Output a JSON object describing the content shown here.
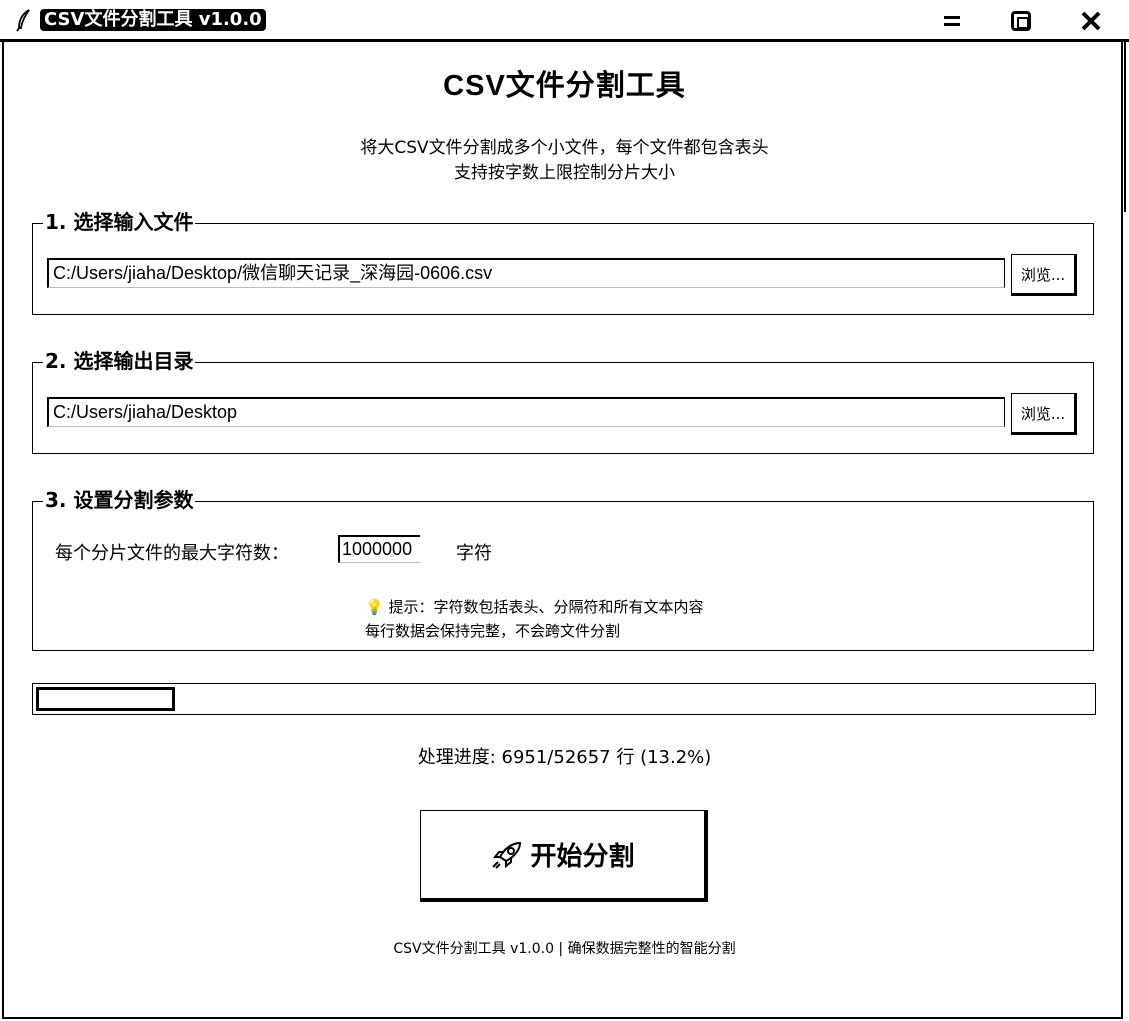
{
  "window": {
    "title": "CSV文件分割工具 v1.0.0",
    "icon": "feather-icon",
    "controls": [
      "minimize-icon",
      "maximize-icon",
      "close-icon"
    ]
  },
  "header": {
    "title": "CSV文件分割工具",
    "description_line1": "将大CSV文件分割成多个小文件，每个文件都包含表头",
    "description_line2": "支持按字数上限控制分片大小"
  },
  "input_section": {
    "label": "1. 选择输入文件",
    "path_value": "C:/Users/jiaha/Desktop/微信聊天记录_深海园-0606.csv",
    "browse_label": "浏览..."
  },
  "output_section": {
    "label": "2. 选择输出目录",
    "path_value": "C:/Users/jiaha/Desktop",
    "browse_label": "浏览..."
  },
  "params_section": {
    "label": "3. 设置分割参数",
    "max_chars_label": "每个分片文件的最大字符数：",
    "max_chars_value": "1000000",
    "unit_label": "字符",
    "tip_line1": "💡 提示：字符数包括表头、分隔符和所有文本内容",
    "tip_line2": "每行数据会保持完整，不会跨文件分割"
  },
  "progress": {
    "fraction": 0.132,
    "status_text": "处理进度: 6951/52657 行 (13.2%)"
  },
  "start_button": {
    "label": "开始分割",
    "icon": "rocket-icon"
  },
  "footer": {
    "text": "CSV文件分割工具 v1.0.0 | 确保数据完整性的智能分割"
  }
}
